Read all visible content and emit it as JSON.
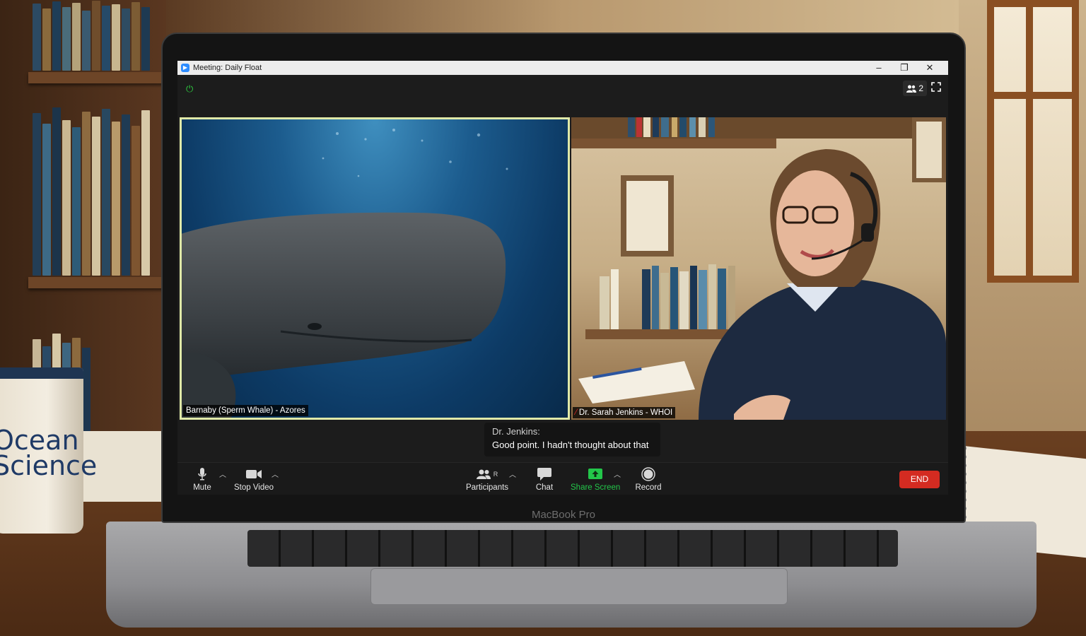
{
  "window": {
    "title": "Meeting: Daily Float",
    "minimize_glyph": "–",
    "restore_glyph": "❐",
    "close_glyph": "✕"
  },
  "topbar": {
    "participant_count": "2",
    "power_icon": "power-icon",
    "fullscreen_icon": "fullscreen-icon"
  },
  "tiles": [
    {
      "name": "Barnaby (Sperm Whale) - Azores",
      "active_speaker": true,
      "muted": false
    },
    {
      "name": "Dr. Sarah Jenkins - WHOI",
      "active_speaker": false,
      "muted": true
    }
  ],
  "caption": {
    "speaker": "Dr. Jenkins:",
    "text": "Good point. I hadn't thought about that"
  },
  "toolbar": {
    "mute_label": "Mute",
    "video_label": "Stop Video",
    "participants_label": "Participants",
    "participants_badge": "R",
    "chat_label": "Chat",
    "share_label": "Share Screen",
    "record_label": "Record",
    "end_label": "END"
  },
  "device": {
    "label": "MacBook Pro"
  },
  "scene": {
    "mug_text": "Ocean\nScience"
  },
  "colors": {
    "share_green": "#23c64a",
    "end_red": "#d42b21",
    "active_border": "#e0e9a8",
    "power_green": "#2ecc40"
  }
}
